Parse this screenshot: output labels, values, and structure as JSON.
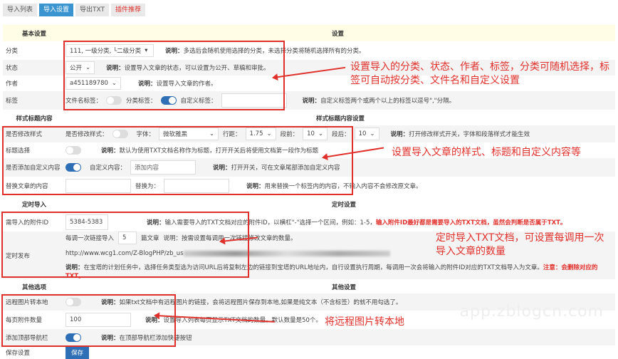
{
  "tabs": [
    "导入列表",
    "导入设置",
    "导出TXT",
    "插件推荐"
  ],
  "basic": {
    "header": "基本设置",
    "header2": "设置",
    "category": {
      "label": "分类",
      "value": "111, 一级分类, └二级分类",
      "desc_key": "说明：",
      "desc": "多选后会随机使用选择的分类，未选择分类将随机选择所有的分类。"
    },
    "status": {
      "label": "状态",
      "value": "公开",
      "desc_key": "说明：",
      "desc": "设置导入文章的状态，可以设置为公开、草稿和审批。"
    },
    "author": {
      "label": "作者",
      "value": "a451189780",
      "desc_key": "说明：",
      "desc": "设置导入文章的作者。"
    },
    "tags": {
      "label": "标签",
      "filename_label": "文件名标签：",
      "filename_on": false,
      "category_label": "分类标签：",
      "category_on": true,
      "custom_label": "自定义标签：",
      "custom_value": "",
      "desc_key": "说明：",
      "desc": "自定义标签两个或两个以上的标签以逗号\",\"分隔。"
    }
  },
  "style": {
    "header": "样式标题内容",
    "header2": "样式标题内容设置",
    "modify": {
      "label": "是否修改样式",
      "toggle_label": "是否修改样式：",
      "on": false,
      "font_label": "字体：",
      "font": "微软雅黑",
      "line_label": "行距：",
      "line": "1.75",
      "before_label": "段前：",
      "before": "10",
      "after_label": "段后：",
      "after": "10",
      "desc_key": "说明：",
      "desc": "打开修改样式开关，字体和段落样式才能生效"
    },
    "title": {
      "label": "标题选择",
      "on": false,
      "desc_key": "说明：",
      "desc": "默认为使用TXT文档名称作为标题，打开开关后将使用文档第一段作为标题"
    },
    "custom": {
      "label": "是否添加自定义内容",
      "on": true,
      "field_label": "自定义内容：",
      "placeholder": "添加内容",
      "desc_key": "说明：",
      "desc": "打开开关，可在文章尾部添加自定义内容"
    },
    "replace": {
      "label": "替换文章的内容",
      "to_label": "替换为：",
      "desc_key": "说明：",
      "desc": "用来替换一个标签内的内容，不输入内容不会修改原文章。"
    }
  },
  "timed": {
    "header": "定时导入",
    "header2": "定时设置",
    "ids": {
      "label": "需导入的附件ID",
      "value": "5384-5383",
      "desc_key": "说明：",
      "desc": "输入需要导入的TXT文档对应的附件ID，以横杠\"-\"选择一个区间，例如：1-5，",
      "desc_red": "输入附件ID最好都是需要导入的TXT文档，虽然会判断是否属于TXT。"
    },
    "publish": {
      "label": "定时发布",
      "count_prefix": "每调一次链接导入",
      "count": "5",
      "count_suffix": "篇文章",
      "count_desc": "说明：按需设置每调用一次链接修改文章的数量。",
      "url": "http://www.wcg1.com/Z-BlogPHP/zb_us",
      "desc_key": "说明：",
      "desc": "在宝塔的计划任务中，选择任务类型选为访问URL后将复制左边的链接到宝塔的URL地址内，自行设置执行周期，每调用一次会将输入的附件ID对应的TXT文档导入为文章。",
      "desc_red": "注意：会删除对应的TXT。"
    }
  },
  "other": {
    "header": "其他选项",
    "header2": "其他设置",
    "remote": {
      "label": "远程图片转本地",
      "on": false,
      "desc_key": "说明：",
      "desc": "如果txt文档中有远程图片的链接，会将远程图片保存到本地,如果是纯文本（不含标签）的就不用勾选了。"
    },
    "perpage": {
      "label": "每页附件数量",
      "value": "100",
      "desc_key": "说明：",
      "desc": "设置导入列表每页显示TXT文档的数量，默认数量是50个。"
    },
    "navbar": {
      "label": "添加顶部导航栏",
      "on": true,
      "desc_key": "说明：",
      "desc": "在顶部导航栏添加快捷按钮"
    },
    "save": {
      "label": "保存设置",
      "button": "保存"
    }
  },
  "annotations": [
    "设置导入的分类、状态、作者、标签，分类可随机选择，标签可自动按分类、文件名和自定义设置",
    "设置导入文章的样式、标题和自定义内容等",
    "定时导入TXT文档，可设置每调用一次导入文章的数量",
    "将远程图片转本地"
  ],
  "watermark": "app.zblogcn.com"
}
